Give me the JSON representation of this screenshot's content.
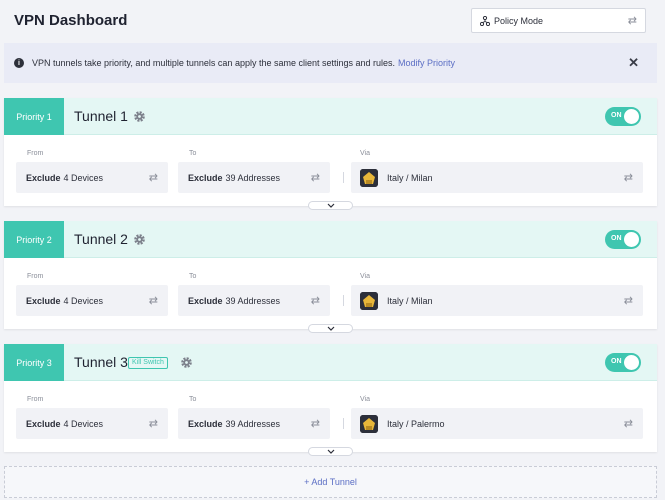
{
  "header": {
    "title": "VPN Dashboard",
    "mode_select": {
      "value": "Policy Mode",
      "icon": "network-icon"
    }
  },
  "notice": {
    "text": "VPN tunnels take priority, and multiple tunnels can apply the same client settings and rules.",
    "link": "Modify Priority"
  },
  "labels": {
    "from": "From",
    "to": "To",
    "via": "Via"
  },
  "tunnels": [
    {
      "priority": "Priority 1",
      "name": "Tunnel 1",
      "toggle": "ON",
      "from_bold": "Exclude",
      "from_rest": "4 Devices",
      "to_bold": "Exclude",
      "to_rest": "39 Addresses",
      "via": "Italy /  Milan"
    },
    {
      "priority": "Priority 2",
      "name": "Tunnel 2",
      "toggle": "ON",
      "from_bold": "Exclude",
      "from_rest": "4 Devices",
      "to_bold": "Exclude",
      "to_rest": "39 Addresses",
      "via": "Italy /  Milan"
    },
    {
      "priority": "Priority 3",
      "name": "Tunnel 3",
      "toggle": "ON",
      "badge": "Kill Switch",
      "from_bold": "Exclude",
      "from_rest": "4 Devices",
      "to_bold": "Exclude",
      "to_rest": "39 Addresses",
      "via": "Italy /  Palermo"
    }
  ],
  "add_tunnel": "+ Add Tunnel",
  "colors": {
    "accent": "#3fc6b0",
    "header_bg": "#e4f7f4",
    "link": "#5b6ec4"
  }
}
